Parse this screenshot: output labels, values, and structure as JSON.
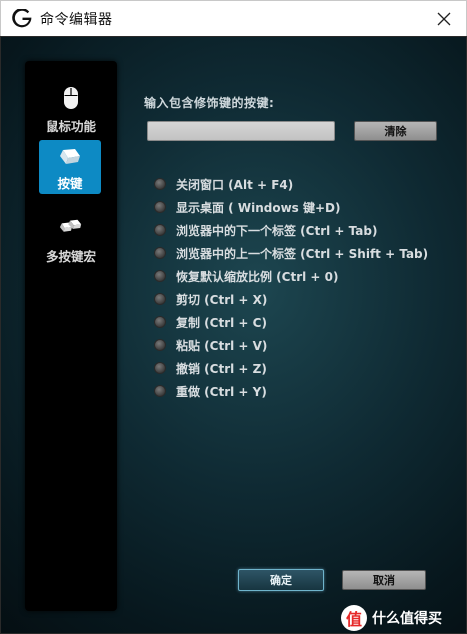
{
  "window": {
    "title": "命令编辑器"
  },
  "sidebar": {
    "items": [
      {
        "label": "鼠标功能",
        "icon": "mouse-icon",
        "active": false
      },
      {
        "label": "按键",
        "icon": "key-icon",
        "active": true
      },
      {
        "label": "多按键宏",
        "icon": "multi-key-icon",
        "active": false
      }
    ]
  },
  "main": {
    "prompt": "输入包含修饰键的按键:",
    "input": {
      "value": "",
      "placeholder": ""
    },
    "clear_label": "清除",
    "options": [
      {
        "label": "关闭窗口 (Alt + F4)"
      },
      {
        "label": "显示桌面 ( Windows 键+D)"
      },
      {
        "label": "浏览器中的下一个标签 (Ctrl + Tab)"
      },
      {
        "label": "浏览器中的上一个标签 (Ctrl + Shift + Tab)"
      },
      {
        "label": "恢复默认缩放比例 (Ctrl + 0)"
      },
      {
        "label": "剪切 (Ctrl + X)"
      },
      {
        "label": "复制 (Ctrl + C)"
      },
      {
        "label": "粘贴 (Ctrl + V)"
      },
      {
        "label": "撤销 (Ctrl + Z)"
      },
      {
        "label": "重做 (Ctrl + Y)"
      }
    ]
  },
  "footer": {
    "ok_label": "确定",
    "cancel_label": "取消"
  },
  "watermark": {
    "badge": "值",
    "text": "什么值得买"
  },
  "colors": {
    "accent": "#0d8ac4",
    "background_dark": "#0f2a33",
    "ok_border": "#6fb4cc"
  }
}
